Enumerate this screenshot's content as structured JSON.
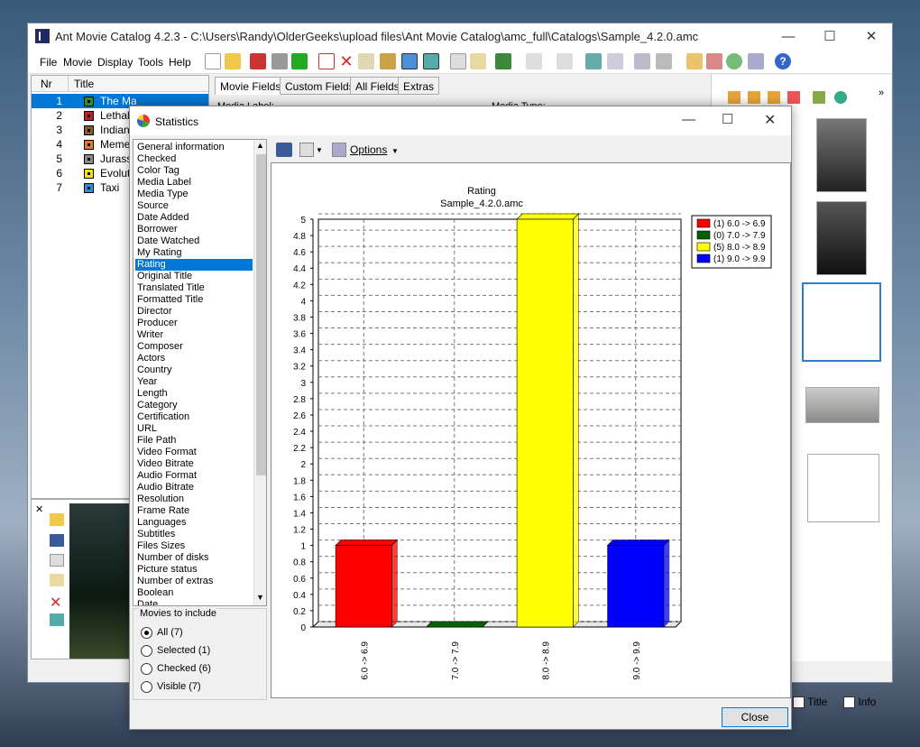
{
  "app": {
    "title": "Ant Movie Catalog 4.2.3 - C:\\Users\\Randy\\OlderGeeks\\upload files\\Ant Movie Catalog\\amc_full\\Catalogs\\Sample_4.2.0.amc",
    "minimize": "—",
    "maximize": "☐",
    "close": "✕"
  },
  "menu": [
    "File",
    "Movie",
    "Display",
    "Tools",
    "Help"
  ],
  "list": {
    "col_nr": "Nr",
    "col_title": "Title",
    "rows": [
      {
        "nr": "1",
        "title": "The Matrix",
        "color": "#2e8b2e"
      },
      {
        "nr": "2",
        "title": "Lethal",
        "color": "#c0201e"
      },
      {
        "nr": "3",
        "title": "Indiana",
        "color": "#8b5a2b"
      },
      {
        "nr": "4",
        "title": "Memen",
        "color": "#e07a30"
      },
      {
        "nr": "5",
        "title": "Jurassi",
        "color": "#8a8a8a"
      },
      {
        "nr": "6",
        "title": "Evoluti",
        "color": "#f3e400"
      },
      {
        "nr": "7",
        "title": "Taxi",
        "color": "#2a8fd8"
      }
    ]
  },
  "tabs": [
    "Movie Fields",
    "Custom Fields",
    "All Fields",
    "Extras"
  ],
  "media_label": "Media Label:",
  "media_type": "Media Type:",
  "bottom_checks": {
    "title": "Title",
    "info": "Info"
  },
  "dialog": {
    "title": "Statistics",
    "options": "Options",
    "fields": [
      "General information",
      "Checked",
      "Color Tag",
      "Media Label",
      "Media Type",
      "Source",
      "Date Added",
      "Borrower",
      "Date Watched",
      "My Rating",
      "Rating",
      "Original Title",
      "Translated Title",
      "Formatted Title",
      "Director",
      "Producer",
      "Writer",
      "Composer",
      "Actors",
      "Country",
      "Year",
      "Length",
      "Category",
      "Certification",
      "URL",
      "File Path",
      "Video Format",
      "Video Bitrate",
      "Audio Format",
      "Audio Bitrate",
      "Resolution",
      "Frame Rate",
      "Languages",
      "Subtitles",
      "Files Sizes",
      "Number of disks",
      "Picture status",
      "Number of extras",
      "Boolean",
      "Date"
    ],
    "selected_field": "Rating",
    "movies_group": "Movies to include",
    "radios": [
      {
        "label": "All (7)",
        "on": true
      },
      {
        "label": "Selected (1)",
        "on": false
      },
      {
        "label": "Checked (6)",
        "on": false
      },
      {
        "label": "Visible (7)",
        "on": false
      }
    ],
    "close": "Close"
  },
  "chart_data": {
    "type": "bar",
    "title": "Rating",
    "subtitle": "Sample_4.2.0.amc",
    "categories": [
      "6.0 -> 6.9",
      "7.0 -> 7.9",
      "8.0 -> 8.9",
      "9.0 -> 9.9"
    ],
    "values": [
      1,
      0,
      5,
      1
    ],
    "colors": [
      "#ff0000",
      "#006400",
      "#ffff00",
      "#0000ff"
    ],
    "legend": [
      "(1) 6.0 -> 6.9",
      "(0) 7.0 -> 7.9",
      "(5) 8.0 -> 8.9",
      "(1) 9.0 -> 9.9"
    ],
    "legend_position": "top-right",
    "ylim": [
      0,
      5
    ],
    "yticks": [
      "0",
      "0.2",
      "0.4",
      "0.6",
      "0.8",
      "1",
      "1.2",
      "1.4",
      "1.6",
      "1.8",
      "2",
      "2.2",
      "2.4",
      "2.6",
      "2.8",
      "3",
      "3.2",
      "3.4",
      "3.6",
      "3.8",
      "4",
      "4.2",
      "4.4",
      "4.6",
      "4.8",
      "5"
    ],
    "grid": true
  }
}
